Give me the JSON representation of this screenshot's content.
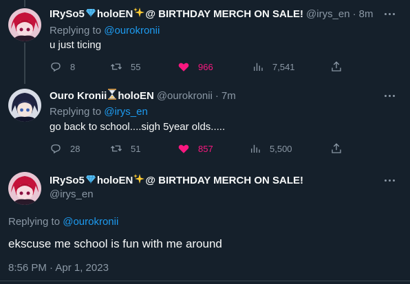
{
  "tweets": [
    {
      "display_name": "IRySo5",
      "name_suffix": "holoEN",
      "name_rest": "@ BIRTHDAY MERCH ON SALE!",
      "handle": "@irys_en",
      "separator": "·",
      "time": "8m",
      "replying_prefix": "Replying to",
      "replying_to": "@ourokronii",
      "text": "u just ticing",
      "replies": "8",
      "retweets": "55",
      "likes": "966",
      "views": "7,541"
    },
    {
      "display_name": "Ouro Kronii",
      "name_suffix": "holoEN",
      "handle": "@ourokronii",
      "separator": "·",
      "time": "7m",
      "replying_prefix": "Replying to",
      "replying_to": "@irys_en",
      "text": "go back to school....sigh 5year olds.....",
      "replies": "28",
      "retweets": "51",
      "likes": "857",
      "views": "5,500"
    }
  ],
  "main_tweet": {
    "display_name": "IRySo5",
    "name_suffix": "holoEN",
    "name_rest": "@ BIRTHDAY MERCH ON SALE!",
    "handle": "@irys_en",
    "replying_prefix": "Replying to",
    "replying_to": "@ourokronii",
    "text": "ekscuse me school is fun with me around",
    "timestamp": "8:56 PM · Apr 1, 2023"
  },
  "colors": {
    "background": "#15202b",
    "accent": "#1d9bf0",
    "like": "#f91880",
    "muted": "#8b98a5"
  },
  "icons": [
    "reply-icon",
    "retweet-icon",
    "heart-icon",
    "views-icon",
    "share-icon",
    "more-icon",
    "diamond-icon",
    "sparkles-icon",
    "hourglass-icon"
  ]
}
